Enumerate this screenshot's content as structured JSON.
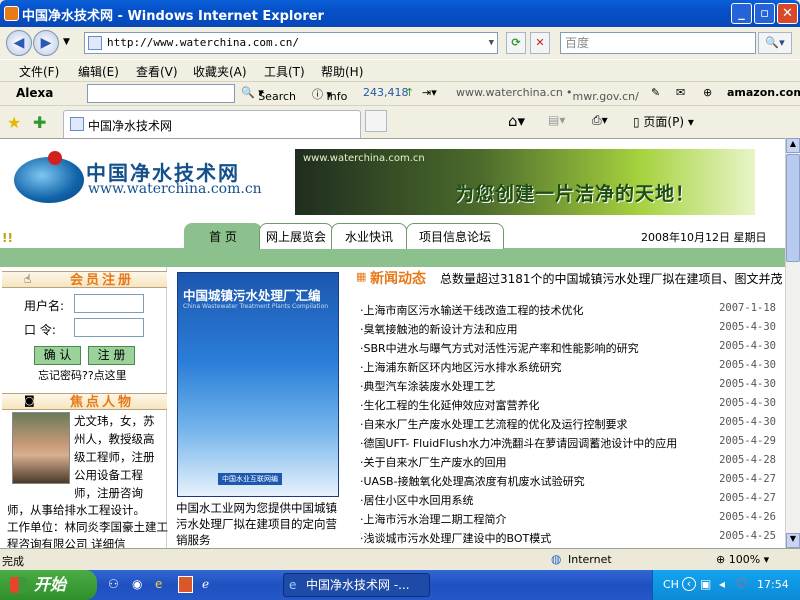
{
  "window": {
    "title": "中国净水技术网 - Windows Internet Explorer",
    "minimize": "_",
    "maximize": "▫",
    "close": "✕"
  },
  "address": {
    "url": "http://www.waterchina.com.cn/",
    "search_placeholder": "百度"
  },
  "menu": [
    "文件(F)",
    "编辑(E)",
    "查看(V)",
    "收藏夹(A)",
    "工具(T)",
    "帮助(H)"
  ],
  "alexa": {
    "brand": "Alexa",
    "search": "Search",
    "info": "Info",
    "rank": "243,418",
    "site": "www.waterchina.cn",
    "mwr": "mwr.gov.cn/",
    "amazon": "amazon.com"
  },
  "tab": {
    "label": "中国净水技术网",
    "page_menu": "页面(P)"
  },
  "site": {
    "logo_cn": "中国净水技术网",
    "logo_url": "www.waterchina.com.cn",
    "banner_url": "www.waterchina.com.cn",
    "slogan": "为您创建一片洁净的天地！",
    "marks": "!!",
    "nav": [
      "首 页",
      "网上展览会",
      "水业快讯",
      "项目信息论坛"
    ],
    "date": "2008年10月12日  星期日"
  },
  "member": {
    "heading": "会员注册",
    "username_label": "用户名:",
    "password_label": "口  令:",
    "confirm_button": "确 认",
    "register_button": "注 册",
    "forgot": "忘记密码??点这里"
  },
  "focus": {
    "heading": "焦点人物",
    "bio_right": "尤文玮，女，苏州人，教授级高级工程师，注册公用设备工程师，注册咨询",
    "bio_full": "师，从事给排水工程设计。",
    "workplace": "工作单位：林同炎李国豪土建工程咨询有限公司  详细信"
  },
  "book": {
    "cover_title": "中国城镇污水处理厂汇编",
    "cover_sub": "China Wastewater Treatment Plants Compilation",
    "cover_pub": "中国水业互联网编",
    "caption": "中国水工业网为您提供中国城镇污水处理厂拟在建项目的定向营销服务"
  },
  "news": {
    "heading": "新闻动态",
    "ticker": "总数量超过3181个的中国城镇污水处理厂拟在建项目、图文并茂",
    "items": [
      {
        "title": "上海市南区污水输送干线改造工程的技术优化",
        "date": "2007-1-18"
      },
      {
        "title": "臭氧接触池的新设计方法和应用",
        "date": "2005-4-30"
      },
      {
        "title": "SBR中进水与曝气方式对活性污泥产率和性能影响的研究",
        "date": "2005-4-30"
      },
      {
        "title": "上海浦东新区环内地区污水排水系统研究",
        "date": "2005-4-30"
      },
      {
        "title": "典型汽车涂装废水处理工艺",
        "date": "2005-4-30"
      },
      {
        "title": "生化工程的生化延伸效应对富营养化",
        "date": "2005-4-30"
      },
      {
        "title": "自来水厂生产废水处理工艺流程的优化及运行控制要求",
        "date": "2005-4-30"
      },
      {
        "title": "德国UFT- FluidFlush水力冲洗翻斗在萝请园调蓄池设计中的应用",
        "date": "2005-4-29"
      },
      {
        "title": "关于自来水厂生产废水的回用",
        "date": "2005-4-28"
      },
      {
        "title": "UASB-接触氧化处理高浓度有机废水试验研究",
        "date": "2005-4-27"
      },
      {
        "title": "居住小区中水回用系统",
        "date": "2005-4-27"
      },
      {
        "title": "上海市污水治理二期工程简介",
        "date": "2005-4-26"
      },
      {
        "title": "浅谈城市污水处理厂建设中的BOT模式",
        "date": "2005-4-25"
      }
    ]
  },
  "status": {
    "left": "完成",
    "zone": "Internet",
    "zoom": "100%"
  },
  "taskbar": {
    "start": "开始",
    "task": "中国净水技术网 -...",
    "lang": "CH",
    "clock": "17:54"
  }
}
